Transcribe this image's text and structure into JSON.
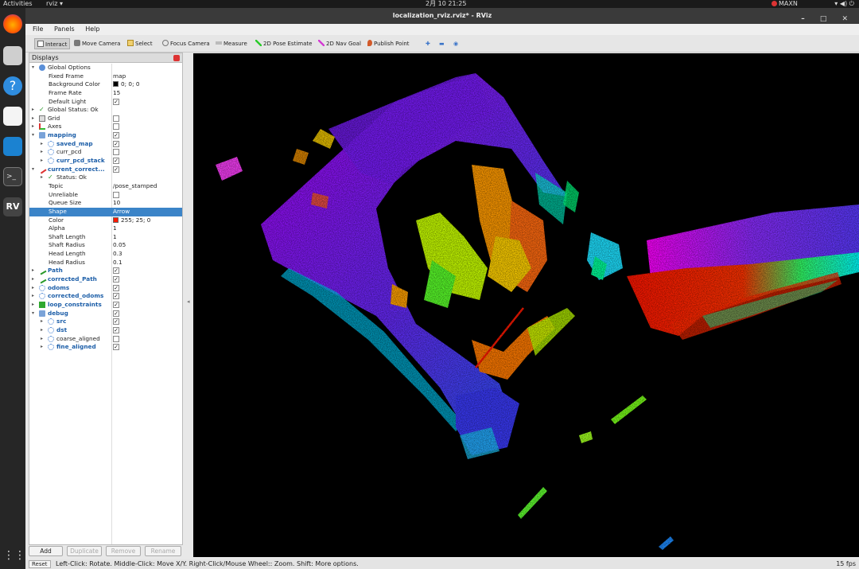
{
  "topbar": {
    "activities": "Activities",
    "app": "rviz ▾",
    "clock": "2月 10  21:25",
    "maxn": "MAXN",
    "tray": "▾  ◀)  ⏻"
  },
  "window": {
    "title": "localization_rviz.rviz* - RViz",
    "controls": "–  □  ✕"
  },
  "menu": {
    "file": "File",
    "panels": "Panels",
    "help": "Help"
  },
  "toolbar": {
    "interact": "Interact",
    "move_camera": "Move Camera",
    "select": "Select",
    "focus_camera": "Focus Camera",
    "measure": "Measure",
    "pose_estimate": "2D Pose Estimate",
    "nav_goal": "2D Nav Goal",
    "publish_point": "Publish Point",
    "plus": "✚",
    "minus": "▬",
    "eye": "◉"
  },
  "panel": {
    "title": "Displays",
    "rows": [
      {
        "indent": 0,
        "arrow": "▾",
        "icon": "gear",
        "name": "Global Options"
      },
      {
        "indent": 1,
        "name": "Fixed Frame",
        "value": "map"
      },
      {
        "indent": 1,
        "name": "Background Color",
        "value": "0; 0; 0",
        "swatch": "#000000"
      },
      {
        "indent": 1,
        "name": "Frame Rate",
        "value": "15"
      },
      {
        "indent": 1,
        "name": "Default Light",
        "check": true
      },
      {
        "indent": 0,
        "arrow": "▸",
        "icon": "ok",
        "name": "Global Status: Ok"
      },
      {
        "indent": 0,
        "arrow": "▸",
        "icon": "grid",
        "name": "Grid",
        "check": false
      },
      {
        "indent": 0,
        "arrow": "▸",
        "icon": "axes",
        "name": "Axes",
        "check": false
      },
      {
        "indent": 0,
        "arrow": "▾",
        "icon": "folder",
        "name": "mapping",
        "blue": true,
        "check": true
      },
      {
        "indent": 1,
        "arrow": "▸",
        "icon": "cloud",
        "name": "saved_map",
        "blue": true,
        "check": true
      },
      {
        "indent": 1,
        "arrow": "▸",
        "icon": "cloud",
        "name": "curr_pcd",
        "check": false
      },
      {
        "indent": 1,
        "arrow": "▸",
        "icon": "cloud",
        "name": "curr_pcd_stack",
        "blue": true,
        "check": true
      },
      {
        "indent": 0,
        "arrow": "▾",
        "icon": "pose",
        "name": "current_correct...",
        "blue": true,
        "check": true
      },
      {
        "indent": 1,
        "arrow": "▸",
        "icon": "ok",
        "name": "Status: Ok"
      },
      {
        "indent": 1,
        "name": "Topic",
        "value": "/pose_stamped"
      },
      {
        "indent": 1,
        "name": "Unreliable",
        "check": false
      },
      {
        "indent": 1,
        "name": "Queue Size",
        "value": "10"
      },
      {
        "indent": 1,
        "name": "Shape",
        "value": "Arrow",
        "selected": true
      },
      {
        "indent": 1,
        "name": "Color",
        "value": "255; 25; 0",
        "swatch": "#ff1900"
      },
      {
        "indent": 1,
        "name": "Alpha",
        "value": "1"
      },
      {
        "indent": 1,
        "name": "Shaft Length",
        "value": "1"
      },
      {
        "indent": 1,
        "name": "Shaft Radius",
        "value": "0.05"
      },
      {
        "indent": 1,
        "name": "Head Length",
        "value": "0.3"
      },
      {
        "indent": 1,
        "name": "Head Radius",
        "value": "0.1"
      },
      {
        "indent": 0,
        "arrow": "▸",
        "icon": "path",
        "name": "Path",
        "blue": true,
        "check": true
      },
      {
        "indent": 0,
        "arrow": "▸",
        "icon": "path",
        "name": "corrected_Path",
        "blue": true,
        "check": true
      },
      {
        "indent": 0,
        "arrow": "▸",
        "icon": "cloud",
        "name": "odoms",
        "blue": true,
        "check": true
      },
      {
        "indent": 0,
        "arrow": "▸",
        "icon": "cloud",
        "name": "corrected_odoms",
        "blue": true,
        "check": true
      },
      {
        "indent": 0,
        "arrow": "▸",
        "icon": "cube",
        "name": "loop_constraints",
        "blue": true,
        "check": true
      },
      {
        "indent": 0,
        "arrow": "▾",
        "icon": "folder",
        "name": "debug",
        "blue": true,
        "check": true
      },
      {
        "indent": 1,
        "arrow": "▸",
        "icon": "cloud",
        "name": "src",
        "blue": true,
        "check": true
      },
      {
        "indent": 1,
        "arrow": "▸",
        "icon": "cloud",
        "name": "dst",
        "blue": true,
        "check": true
      },
      {
        "indent": 1,
        "arrow": "▸",
        "icon": "cloud",
        "name": "coarse_aligned",
        "check": false
      },
      {
        "indent": 1,
        "arrow": "▸",
        "icon": "cloud",
        "name": "fine_aligned",
        "blue": true,
        "check": true
      }
    ],
    "buttons": {
      "add": "Add",
      "duplicate": "Duplicate",
      "remove": "Remove",
      "rename": "Rename"
    }
  },
  "status": {
    "reset": "Reset",
    "help": "Left-Click: Rotate. Middle-Click: Move X/Y. Right-Click/Mouse Wheel:: Zoom. Shift: More options.",
    "fps": "15 fps"
  },
  "colors": {
    "accent": "#3b84c8",
    "selection": "#3b84c8",
    "name_blue": "#1c5ea8"
  }
}
